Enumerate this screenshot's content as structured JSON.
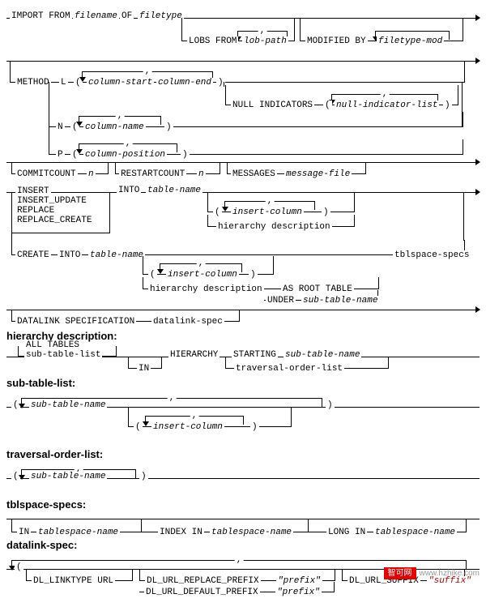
{
  "chart_data": {
    "type": "diagram",
    "syntax": "railroad",
    "statement": "IMPORT",
    "main_sequence": [
      "IMPORT FROM <filename> OF <filetype>",
      "[ LOBS FROM <lob-path> , ... ]",
      "[ MODIFIED BY <filetype-mod> ... ]",
      "[ METHOD { L ( <column-start> <column-end> , ... ) [ NULL INDICATORS ( <null-indicator-list> , ... ) ] | N ( <column-name> , ... ) | P ( <column-position> , ... ) } ]",
      "[ COMMITCOUNT <n> ]",
      "[ RESTARTCOUNT <n> ]",
      "[ MESSAGES <message-file> ]",
      "{ { INSERT | INSERT_UPDATE | REPLACE | REPLACE_CREATE } INTO <table-name> [ ( <insert-column> , ... ) | hierarchy description ] | CREATE INTO <table-name> [ ( <insert-column> , ... ) | hierarchy description { AS ROOT TABLE | UNDER <sub-table-name> } ] tblspace-specs }",
      "[ DATALINK SPECIFICATION datalink-spec ]"
    ],
    "fragments": {
      "hierarchy description": "{ ALL TABLES | sub-table-list } [ IN ] HIERARCHY { STARTING <sub-table-name> | traversal-order-list }",
      "sub-table-list": "( <sub-table-name> [ ( <insert-column> , ... ) ] , ... )",
      "traversal-order-list": "( <sub-table-name> , ... )",
      "tblspace-specs": "[ IN <tablespace-name> [ INDEX IN <tablespace-name> ] [ LONG IN <tablespace-name> ] ]",
      "datalink-spec": "( [ DL_LINKTYPE URL ] [ DL_URL_REPLACE_PREFIX \"<prefix>\" | DL_URL_DEFAULT_PREFIX \"<prefix>\" ] [ DL_URL_SUFFIX \"<suffix>\" ] ) , ..."
    }
  },
  "r1": {
    "kw1": "IMPORT FROM",
    "v1": "filename",
    "kw2": "OF",
    "v2": "filetype"
  },
  "r1b": {
    "kw": "LOBS FROM",
    "v": "lob-path",
    "sep": ","
  },
  "r1c": {
    "kw": "MODIFIED BY",
    "v": "filetype-mod"
  },
  "method": {
    "kw": "METHOD",
    "L": {
      "tag": "L",
      "v1": "column-start",
      "v2": "column-end",
      "sep": ",",
      "null_kw": "NULL INDICATORS",
      "null_v": "null-indicator-list"
    },
    "N": {
      "tag": "N",
      "v": "column-name",
      "sep": ","
    },
    "P": {
      "tag": "P",
      "v": "column-position",
      "sep": ","
    }
  },
  "opts": {
    "commit": "COMMITCOUNT",
    "n1": "n",
    "restart": "RESTARTCOUNT",
    "n2": "n",
    "msgs": "MESSAGES",
    "mf": "message-file"
  },
  "modes": {
    "a": "INSERT",
    "b": "INSERT_UPDATE",
    "c": "REPLACE",
    "d": "REPLACE_CREATE",
    "into": "INTO",
    "tn": "table-name",
    "ic": "insert-column",
    "hd": "hierarchy description",
    "sep": ","
  },
  "create": {
    "kw": "CREATE",
    "into": "INTO",
    "tn": "table-name",
    "ic": "insert-column",
    "hd": "hierarchy description",
    "root": "AS ROOT TABLE",
    "under": "UNDER",
    "stn": "sub-table-name",
    "tbs": "tblspace-specs",
    "sep": ","
  },
  "dl": {
    "kw": "DATALINK SPECIFICATION",
    "v": "datalink-spec"
  },
  "hdesc": {
    "title": "hierarchy description:",
    "all": "ALL TABLES",
    "stl": "sub-table-list",
    "in": "IN",
    "hier": "HIERARCHY",
    "start": "STARTING",
    "stn": "sub-table-name",
    "tol": "traversal-order-list"
  },
  "stl": {
    "title": "sub-table-list:",
    "v": "sub-table-name",
    "ic": "insert-column",
    "sep": ","
  },
  "tol": {
    "title": "traversal-order-list:",
    "v": "sub-table-name",
    "sep": ","
  },
  "tbs": {
    "title": "tblspace-specs:",
    "in": "IN",
    "tn": "tablespace-name",
    "idx": "INDEX IN",
    "long": "LONG IN"
  },
  "dspec": {
    "title": "datalink-spec:",
    "lt": "DL_LINKTYPE URL",
    "rp": "DL_URL_REPLACE_PREFIX",
    "dp": "DL_URL_DEFAULT_PREFIX",
    "pfx": "\"prefix\"",
    "sfx_kw": "DL_URL_SUFFIX",
    "sfx": "\"suffix\"",
    "sep": ","
  },
  "paren": {
    "l": "(",
    "r": ")"
  },
  "wm": {
    "tag": "智可网",
    "url": "www.hzhike.com"
  }
}
